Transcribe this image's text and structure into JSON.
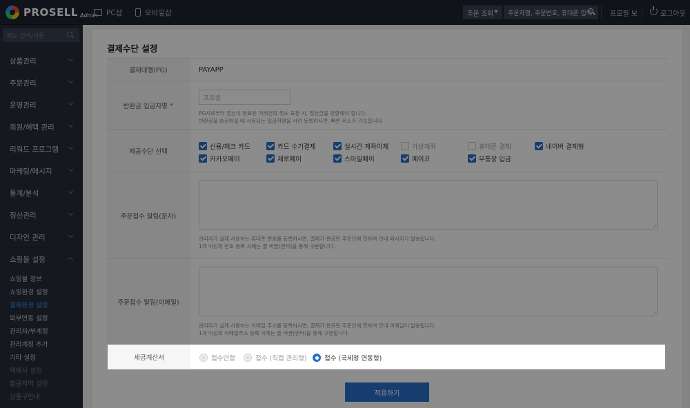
{
  "app": {
    "logo": "PROSELL",
    "logo_sub": "Admin"
  },
  "topnav": {
    "pc": "PC샵",
    "mobile": "모바일샵"
  },
  "top_search": {
    "select": "주문 조회",
    "placeholder": "주문자명, 주문번호, 휴대폰 입력"
  },
  "top_links": {
    "profile": "프로필 보",
    "logout": "로그아웃"
  },
  "sidebar": {
    "search_placeholder": "메뉴 검색/이동",
    "items": [
      {
        "label": "상품관리"
      },
      {
        "label": "주문관리"
      },
      {
        "label": "운영관리"
      },
      {
        "label": "회원/혜택 관리"
      },
      {
        "label": "리워드 프로그램"
      },
      {
        "label": "마케팅/메시지"
      },
      {
        "label": "통계/분석"
      },
      {
        "label": "정산관리"
      },
      {
        "label": "디자인 관리"
      },
      {
        "label": "쇼핑몰 설정"
      }
    ],
    "sub_items": [
      {
        "label": "쇼핑몰 정보"
      },
      {
        "label": "쇼핑환경 설정"
      },
      {
        "label": "결제환경 설정"
      },
      {
        "label": "외부연동 설정"
      },
      {
        "label": "관리자/부계정"
      },
      {
        "label": "관리계정 추가"
      },
      {
        "label": "기타 설정"
      },
      {
        "label": "택배사 설정"
      },
      {
        "label": "불공지역 설정"
      },
      {
        "label": "상품구안내"
      }
    ]
  },
  "page": {
    "title": "결제수단 설정"
  },
  "form": {
    "pg": {
      "label": "결제대행(PG)",
      "value": "PAYAPP"
    },
    "refund": {
      "label": "반환금 입금자명",
      "required_mark": "•",
      "placeholder": "프로셀",
      "help1": "PG사로부터 정산이 완료된 거래건의 취소 요청 시, 정산금을 반환해야 합니다.",
      "help2": "반환금을 송금하실 때 사용되는 입금자명을 사전 등록하시면, 빠른 취소가 가능합니다."
    },
    "methods": {
      "label": "제공수단 선택",
      "options": [
        {
          "label": "신용/체크 카드",
          "checked": true
        },
        {
          "label": "카드 수기결제",
          "checked": true
        },
        {
          "label": "실시간 계좌이체",
          "checked": true
        },
        {
          "label": "가상계좌",
          "checked": false
        },
        {
          "label": "휴대폰 결제",
          "checked": false
        },
        {
          "label": "네이버 결제형",
          "checked": true
        },
        {
          "label": "카카오페이",
          "checked": true
        },
        {
          "label": "제로페이",
          "checked": true
        },
        {
          "label": "스마일페이",
          "checked": true
        },
        {
          "label": "페이코",
          "checked": true
        },
        {
          "label": "무통장 입금",
          "checked": true
        }
      ]
    },
    "sms": {
      "label": "주문접수 알림(문자)",
      "help1": "관리자가 실제 사용하는 휴대폰 번호를 등록하시면, 결제가 완료된 주문건에 한하여 안내 메시지가 발송됩니다.",
      "help2": "1개 이상의 번호 등록 시에는 줄 바꿈(엔터)을 통해 구분합니다."
    },
    "email": {
      "label": "주문접수 알림(이메일)",
      "help1": "관리자가 실제 사용하는 이메일 주소를 등록하시면, 결제가 완료된 주문건에 한하여 안내 이메일이 발송됩니다.",
      "help2": "1개 이상의 이메일주소 등록 시에는 줄 바꿈(엔터)을 통해 구분합니다."
    },
    "tax": {
      "label": "세금계산서",
      "options": [
        {
          "label": "접수안함",
          "selected": false
        },
        {
          "label": "접수 (직접 관리형)",
          "selected": false
        },
        {
          "label": "접수 (국세청 연동형)",
          "selected": true
        }
      ]
    }
  },
  "apply_button": "적용하기",
  "colors": {
    "accent": "#2a6fc9",
    "sidebar": "#272d39",
    "topbar": "#1e2431"
  }
}
